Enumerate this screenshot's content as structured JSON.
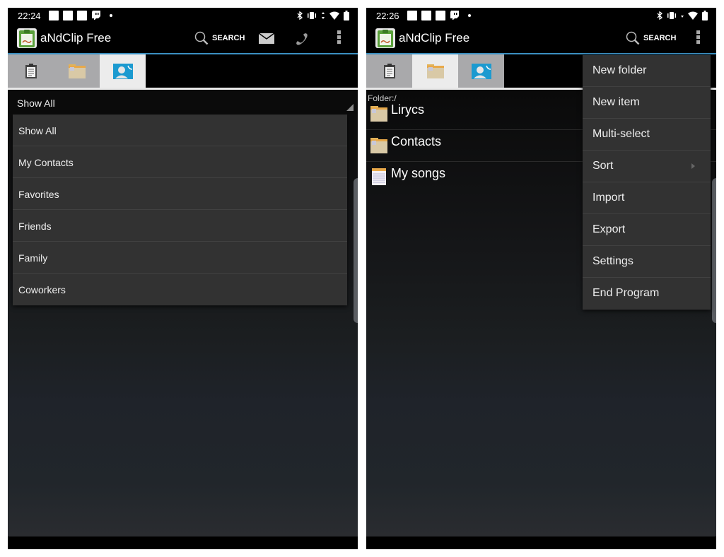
{
  "screens": {
    "left": {
      "status_time": "22:24",
      "app_title": "aNdClip Free",
      "search_label": "SEARCH",
      "tabs": [
        {
          "icon": "clipboard-icon",
          "active": false
        },
        {
          "icon": "folder-icon",
          "active": false
        },
        {
          "icon": "contacts-icon",
          "active": true
        }
      ],
      "spinner_value": "Show All",
      "dropdown_options": [
        "Show All",
        "My Contacts",
        "Favorites",
        "Friends",
        "Family",
        "Coworkers"
      ]
    },
    "right": {
      "status_time": "22:26",
      "app_title": "aNdClip Free",
      "search_label": "SEARCH",
      "tabs": [
        {
          "icon": "clipboard-icon",
          "active": false
        },
        {
          "icon": "folder-icon",
          "active": true
        },
        {
          "icon": "contacts-icon",
          "active": false
        }
      ],
      "folder_path": "Folder:/",
      "items": [
        {
          "label": "Lirycs",
          "icon": "folder-icon"
        },
        {
          "label": "Contacts",
          "icon": "folder-icon"
        },
        {
          "label": "My songs",
          "icon": "note-icon"
        }
      ],
      "overflow_menu": [
        "New folder",
        "New item",
        "Multi-select",
        "Sort",
        "Import",
        "Export",
        "Settings",
        "End Program"
      ]
    }
  },
  "colors": {
    "accent_line": "#3b8fc0",
    "menu_bg": "#323232",
    "tab_inactive": "#a9a9ab",
    "tab_active": "#ececec"
  }
}
